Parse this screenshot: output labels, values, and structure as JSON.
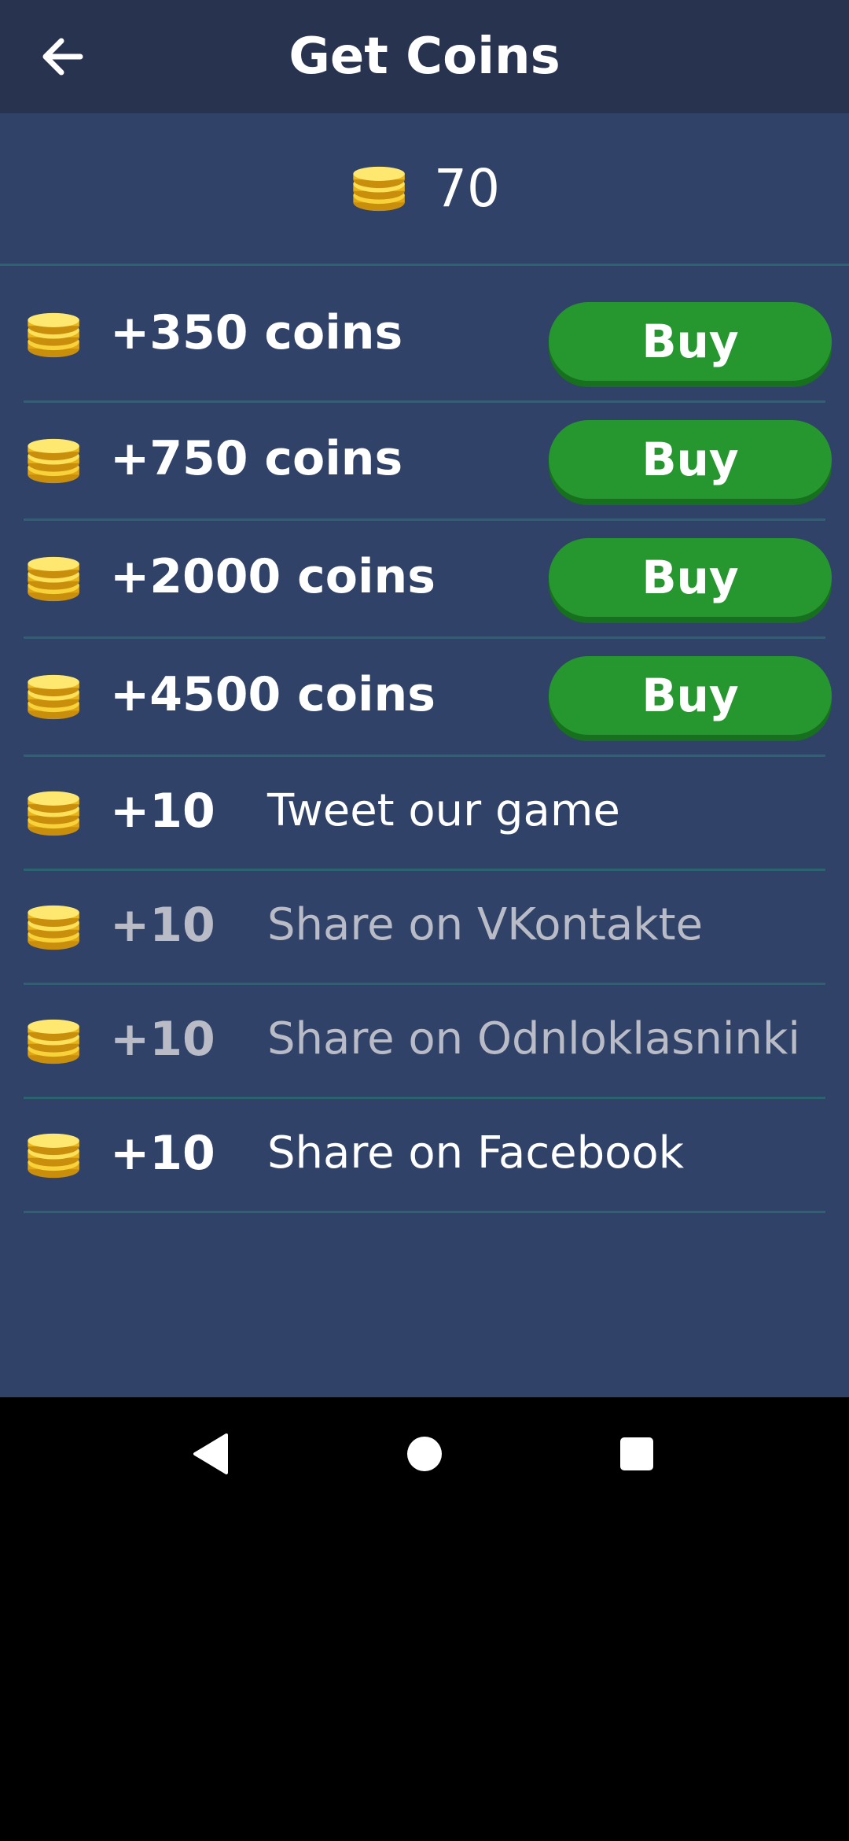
{
  "header": {
    "title": "Get Coins",
    "back_icon": "arrow-left-icon"
  },
  "balance": {
    "value": "70",
    "icon": "coin-stack-icon"
  },
  "purchases": [
    {
      "amount": "+350 coins",
      "button": "Buy"
    },
    {
      "amount": "+750 coins",
      "button": "Buy"
    },
    {
      "amount": "+2000 coins",
      "button": "Buy"
    },
    {
      "amount": "+4500 coins",
      "button": "Buy"
    }
  ],
  "rewards": [
    {
      "amount": "+10",
      "label": "Tweet our game",
      "enabled": true
    },
    {
      "amount": "+10",
      "label": "Share on VKontakte",
      "enabled": false
    },
    {
      "amount": "+10",
      "label": "Share on Odnloklasninki",
      "enabled": false
    },
    {
      "amount": "+10",
      "label": "Share on Facebook",
      "enabled": true
    }
  ],
  "colors": {
    "background": "#314268",
    "header": "#28344f",
    "buy_button": "#26972f",
    "divider": "#2b6470",
    "coin": "#f2c21b"
  },
  "navbar": {
    "back_icon": "triangle-back-icon",
    "home_icon": "circle-home-icon",
    "recents_icon": "square-recents-icon"
  }
}
